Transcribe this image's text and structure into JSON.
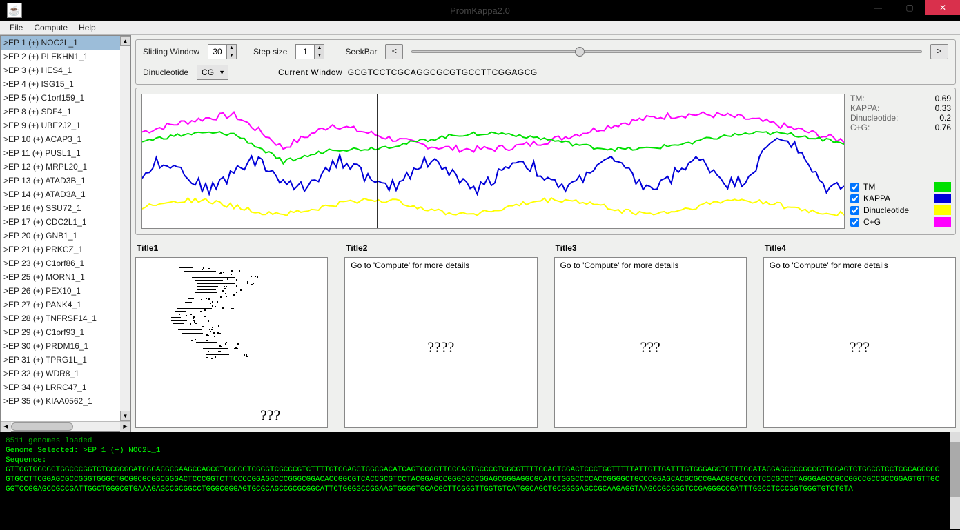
{
  "window": {
    "title": "PromKappa2.0"
  },
  "menu": {
    "items": [
      "File",
      "Compute",
      "Help"
    ]
  },
  "sidebar": {
    "items": [
      ">EP 1 (+) NOC2L_1",
      ">EP 2 (+) PLEKHN1_1",
      ">EP 3 (+) HES4_1",
      ">EP 4 (+) ISG15_1",
      ">EP 5 (+) C1orf159_1",
      ">EP 8 (+) SDF4_1",
      ">EP 9 (+) UBE2J2_1",
      ">EP 10 (+) ACAP3_1",
      ">EP 11 (+) PUSL1_1",
      ">EP 12 (+) MRPL20_1",
      ">EP 13 (+) ATAD3B_1",
      ">EP 14 (+) ATAD3A_1",
      ">EP 16 (+) SSU72_1",
      ">EP 17 (+) CDC2L1_1",
      ">EP 20 (+) GNB1_1",
      ">EP 21 (+) PRKCZ_1",
      ">EP 23 (+) C1orf86_1",
      ">EP 25 (+) MORN1_1",
      ">EP 26 (+) PEX10_1",
      ">EP 27 (+) PANK4_1",
      ">EP 28 (+) TNFRSF14_1",
      ">EP 29 (+) C1orf93_1",
      ">EP 30 (+) PRDM16_1",
      ">EP 31 (+) TPRG1L_1",
      ">EP 32 (+) WDR8_1",
      ">EP 34 (+) LRRC47_1",
      ">EP 35 (+) KIAA0562_1"
    ],
    "selected_index": 0
  },
  "controls": {
    "sliding_window_label": "Sliding Window",
    "sliding_window_value": "30",
    "step_size_label": "Step size",
    "step_size_value": "1",
    "seekbar_label": "SeekBar",
    "prev_label": "<",
    "next_label": ">",
    "dinucleotide_label": "Dinucleotide",
    "dinucleotide_selected": "CG",
    "current_window_label": "Current Window",
    "current_window_value": "GCGTCCTCGCAGGCGCGTGCCTTCGGAGCG"
  },
  "stats": {
    "tm_label": "TM:",
    "tm_value": "0.69",
    "kappa_label": "KAPPA:",
    "kappa_value": "0.33",
    "din_label": "Dinucleotide:",
    "din_value": "0.2",
    "cg_label": "C+G:",
    "cg_value": "0.76"
  },
  "legend": {
    "tm": "TM",
    "kappa": "KAPPA",
    "din": "Dinucleotide",
    "cg": "C+G",
    "colors": {
      "tm": "#00e000",
      "kappa": "#0000d8",
      "din": "#ffff00",
      "cg": "#ff00ff"
    }
  },
  "panels": {
    "p1": {
      "title": "Title1",
      "big": "???"
    },
    "p2": {
      "title": "Title2",
      "msg": "Go to 'Compute' for more details",
      "big": "????"
    },
    "p3": {
      "title": "Title3",
      "msg": "Go to 'Compute' for more details",
      "big": "???"
    },
    "p4": {
      "title": "Title4",
      "msg": "Go to 'Compute' for more details",
      "big": "???"
    }
  },
  "console": {
    "lines": [
      "8511 genomes loaded",
      "Genome Selected: >EP 1 (+) NOC2L_1",
      "Sequence:",
      "GTTCGTGGCGCTGGCCCGGTCTCCGCGGATCGGAGGCGAAGCCAGCCTGGCCCTCGGGTCGCCCGTCTTTTGTCGAGCTGGCGACATCAGTGCGGTTCCCACTGCCCCTCGCGTTTTCCACTGGACTCCCTGCTTTTTATTGTTGATTTGTGGGAGCTCTTTGCATAGGAGCCCCGCCGTTGCAGTCTGGCGTCCTCGCAGGCGCGTGCCTTCGGAGCGCCGGGTGGGCTGCGGCGCGGCGGGACTCCCGGTCTTCCCCGGAGGCCCGGGCGGACACCGGCGTCACCGCGTCCTACGGAGCCGGGCGCCGGAGCGGGAGGCGCATCTGGGCCCCACCGGGGCTGCCCGGAGCACGCGCCGAACGCGCCCCTCCCGCCCTAGGGAGCCGCCGGCCGCCGCCGGAGTGTTGCGGTCCGGAGCCGCCGATTGGCTGGGCGTGAAAGAGCCGCGGCCTGGGCGGGAGTGCGCAGCCGCGCGGCATTCTGGGGCCGGAAGTGGGGTGCACGCTTCGGGTTGGTGTCATGGCAGCTGCGGGGAGCCGCAAGAGGTAAGCCGCGGGTCCGAGGGCCGATTTGGCCTCCCGGTGGGTGTCTGTA"
    ]
  },
  "chart_data": {
    "type": "line",
    "x_count": 200,
    "ylim": [
      0,
      1
    ],
    "cursor_x": 67,
    "series": [
      {
        "name": "C+G",
        "color": "#ff00ff",
        "mean": 0.72,
        "amp": 0.13,
        "freq": 0.05,
        "noise": 0.05,
        "dip_center": 40,
        "dip_width": 14,
        "dip_depth": 0.24
      },
      {
        "name": "TM",
        "color": "#00e000",
        "mean": 0.65,
        "amp": 0.06,
        "freq": 0.08,
        "noise": 0.03,
        "dip_center": 40,
        "dip_width": 14,
        "dip_depth": 0.15
      },
      {
        "name": "KAPPA",
        "color": "#0000d8",
        "mean": 0.4,
        "amp": 0.1,
        "freq": 0.25,
        "noise": 0.1,
        "dip_center": 180,
        "dip_width": 14,
        "dip_depth": -0.2
      },
      {
        "name": "Dinucleotide",
        "color": "#ffff00",
        "mean": 0.16,
        "amp": 0.05,
        "freq": 0.12,
        "noise": 0.04,
        "dip_center": 0,
        "dip_width": 1,
        "dip_depth": 0
      }
    ]
  }
}
